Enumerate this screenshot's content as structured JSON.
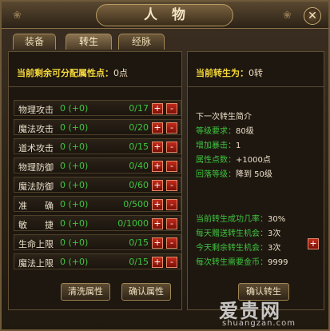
{
  "window": {
    "title": "人物",
    "close_glyph": "✕"
  },
  "tabs": [
    {
      "label": "装备",
      "active": false
    },
    {
      "label": "转生",
      "active": true
    },
    {
      "label": "经脉",
      "active": false
    }
  ],
  "left_panel": {
    "header_label": "当前剩余可分配属性点：",
    "header_value": "0点",
    "attributes": [
      {
        "name": "物理攻击",
        "current": "0 (+0)",
        "max": "0/17"
      },
      {
        "name": "魔法攻击",
        "current": "0 (+0)",
        "max": "0/20"
      },
      {
        "name": "道术攻击",
        "current": "0 (+0)",
        "max": "0/15"
      },
      {
        "name": "物理防御",
        "current": "0 (+0)",
        "max": "0/40"
      },
      {
        "name": "魔法防御",
        "current": "0 (+0)",
        "max": "0/60"
      },
      {
        "name": "准　　确",
        "current": "0 (+0)",
        "max": "0/500"
      },
      {
        "name": "敏　　捷",
        "current": "0 (+0)",
        "max": "0/1000"
      },
      {
        "name": "生命上限",
        "current": "0 (+0)",
        "max": "0/15"
      },
      {
        "name": "魔法上限",
        "current": "0 (+0)",
        "max": "0/15"
      }
    ],
    "plus_label": "+",
    "minus_label": "-",
    "clear_button": "清洗属性",
    "confirm_button": "确认属性"
  },
  "right_panel": {
    "header_label": "当前转生为：",
    "header_value": "0转",
    "next_intro": "下一次转生简介",
    "level_req_label": "等级要求：",
    "level_req_value": "80级",
    "crit_label": "增加暴击：",
    "crit_value": "1",
    "points_label": "属性点数：",
    "points_value": "+1000点",
    "drop_label": "回落等级：",
    "drop_value": "降到 50级",
    "success_label": "当前转生成功几率：",
    "success_value": "30%",
    "gift_label": "每天赠送转生机会：",
    "gift_value": "3次",
    "remain_label": "今天剩余转生机会：",
    "remain_value": "3次",
    "gold_label": "每次转生需要金币：",
    "gold_value": "9999",
    "remain_plus": "+",
    "confirm_rebirth_button": "确认转生"
  },
  "watermark": {
    "logo": "爱贵网",
    "url": "shuangzan.com"
  }
}
